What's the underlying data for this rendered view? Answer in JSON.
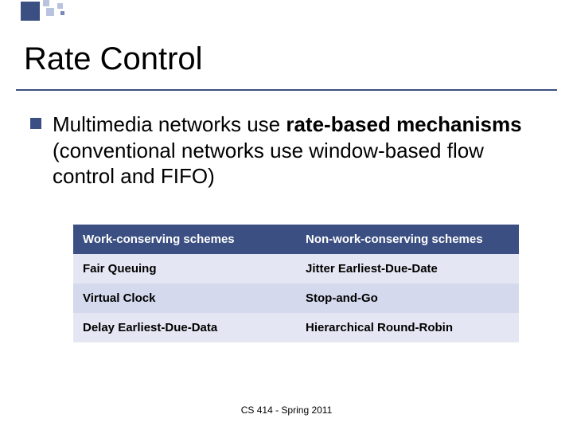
{
  "title": "Rate Control",
  "bullet": {
    "prefix": "Multimedia networks use ",
    "bold": "rate-based mechanisms",
    "suffix": " (conventional networks use window-based flow control and FIFO)"
  },
  "table": {
    "header": {
      "col1": "Work-conserving schemes",
      "col2": "Non-work-conserving schemes"
    },
    "rows": [
      {
        "col1": "Fair Queuing",
        "col2": "Jitter Earliest-Due-Date"
      },
      {
        "col1": "Virtual Clock",
        "col2": "Stop-and-Go"
      },
      {
        "col1": "Delay Earliest-Due-Data",
        "col2": "Hierarchical Round-Robin"
      }
    ]
  },
  "footer": "CS 414 - Spring 2011"
}
